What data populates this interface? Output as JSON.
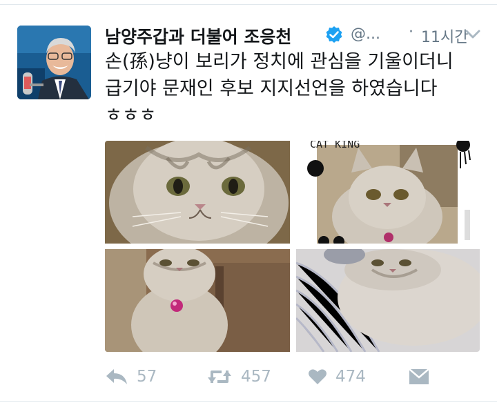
{
  "tweet": {
    "author": {
      "display_name": "남양주갑과 더불어 조응천",
      "handle": "@...",
      "verified": true
    },
    "separator": "·",
    "timestamp": "11시간",
    "text_lines": [
      "손(孫)냥이 보리가 정치에 관심을 기울이더니",
      "급기야 문재인 후보 지지선언을 하였습니다",
      "ㅎㅎㅎ"
    ],
    "photo_overlay_text": "CAT KING",
    "actions": {
      "reply": {
        "icon": "reply-icon",
        "count": "57"
      },
      "retweet": {
        "icon": "retweet-icon",
        "count": "457"
      },
      "like": {
        "icon": "heart-icon",
        "count": "474"
      },
      "message": {
        "icon": "envelope-icon"
      }
    },
    "colors": {
      "verified_badge": "#1da1f2",
      "meta_text": "#657786",
      "action_icon": "#aab8c2",
      "text": "#14171a"
    }
  }
}
